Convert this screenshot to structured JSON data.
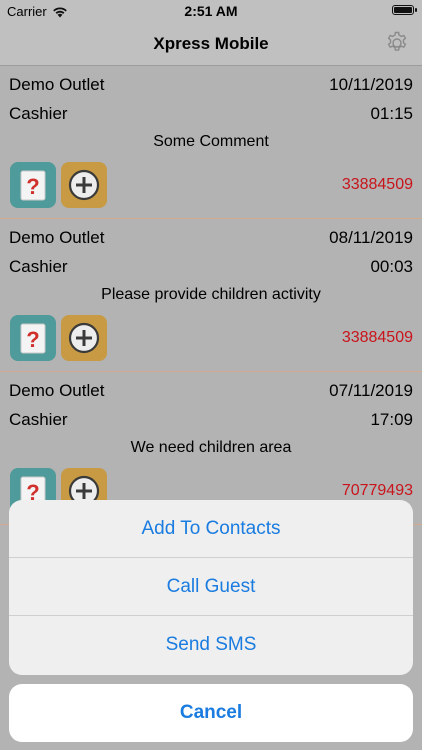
{
  "status_bar": {
    "carrier": "Carrier",
    "time": "2:51 AM"
  },
  "nav": {
    "title": "Xpress Mobile",
    "settings_icon": "gear-icon"
  },
  "entries": [
    {
      "outlet": "Demo Outlet",
      "date": "10/11/2019",
      "role": "Cashier",
      "duration": "01:15",
      "comment": "Some Comment",
      "phone": "33884509"
    },
    {
      "outlet": "Demo Outlet",
      "date": "08/11/2019",
      "role": "Cashier",
      "duration": "00:03",
      "comment": "Please provide children activity",
      "phone": "33884509"
    },
    {
      "outlet": "Demo Outlet",
      "date": "07/11/2019",
      "role": "Cashier",
      "duration": "17:09",
      "comment": "We need children area",
      "phone": "70779493"
    }
  ],
  "action_sheet": {
    "actions": [
      "Add To Contacts",
      "Call Guest",
      "Send SMS"
    ],
    "cancel": "Cancel"
  },
  "colors": {
    "accent": "#1a7ce0",
    "phone": "#c9141b",
    "question_button": "#4f9a9a",
    "add_button": "#c79a43"
  }
}
